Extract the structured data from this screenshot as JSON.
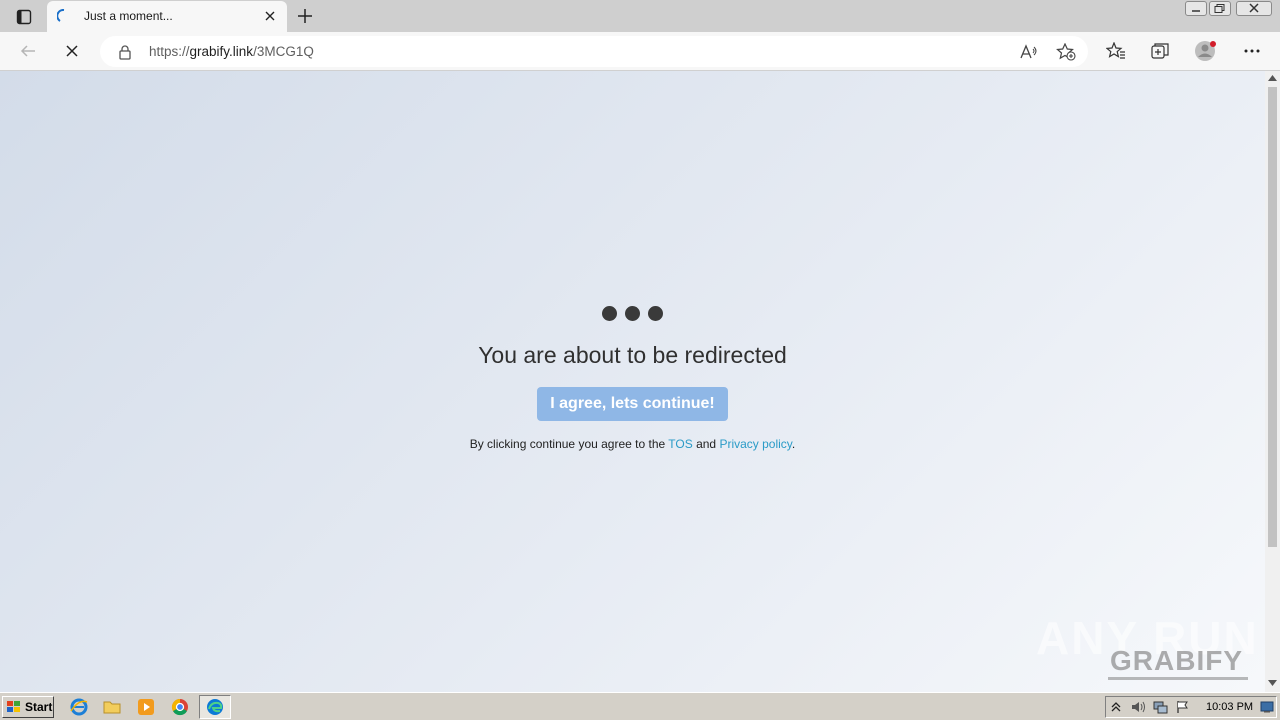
{
  "browser": {
    "tab": {
      "title": "Just a moment..."
    },
    "url": {
      "scheme": "https://",
      "host": "grabify.link",
      "path": "/3MCG1Q"
    }
  },
  "page": {
    "message": "You are about to be redirected",
    "continue_label": "I agree, lets continue!",
    "agree_prefix": "By clicking continue you agree to the ",
    "tos_label": "TOS",
    "agree_and": " and ",
    "privacy_label": "Privacy policy",
    "agree_suffix": ".",
    "colors": {
      "button": "#8fb7e6",
      "link": "#2a9bc7"
    }
  },
  "watermark": {
    "brand": "ANY RUN",
    "site": "GRABIFY"
  },
  "taskbar": {
    "start_label": "Start",
    "clock": "10:03 PM",
    "pinned": [
      "ie-icon",
      "folder-icon",
      "media-player-icon",
      "chrome-icon",
      "edge-icon"
    ]
  }
}
